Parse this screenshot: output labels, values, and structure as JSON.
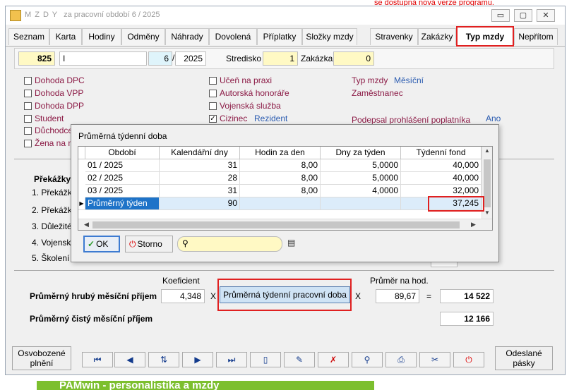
{
  "background": {
    "notice": "se dostupná nová verze programu.",
    "banner": "PAMwin - personalistika a mzdy"
  },
  "window": {
    "title": "M Z D Y",
    "subtitle": "za pracovní období  6 / 2025"
  },
  "tabs": [
    "Seznam",
    "Karta",
    "Hodiny",
    "Odměny",
    "Náhrady",
    "Dovolená",
    "Příplatky",
    "Složky mzdy",
    "Stravenky",
    "Zakázky",
    "Typ mzdy",
    "Nepřítom"
  ],
  "header": {
    "id": "825",
    "name": "I",
    "month": "6",
    "slash": "/",
    "year": "2025",
    "stredisko_label": "Stredisko",
    "stredisko": "1",
    "zakazka_label": "Zakázka",
    "zakazka": "0"
  },
  "checks_left": [
    {
      "label": "Dohoda DPC",
      "checked": false
    },
    {
      "label": "Dohoda VPP",
      "checked": false
    },
    {
      "label": "Dohoda DPP",
      "checked": false
    },
    {
      "label": "Student",
      "checked": false
    },
    {
      "label": "Důchodce",
      "checked": false
    },
    {
      "label": "Žena na m",
      "checked": false
    }
  ],
  "checks_mid": [
    {
      "label": "Učeň na praxi",
      "checked": false
    },
    {
      "label": "Autorská honoráře",
      "checked": false
    },
    {
      "label": "Vojenská služba",
      "checked": false
    },
    {
      "label": "Cizinec",
      "checked": true
    }
  ],
  "info": {
    "rezident": "Rezident",
    "typ_mzdy_label": "Typ mzdy",
    "typ_mzdy": "Měsíční",
    "zamestnanec": "Zaměstnanec",
    "prohlaseni_label": "Podepsal prohlášení poplatníka",
    "prohlaseni": "Ano"
  },
  "obstacles": {
    "title": "Překážky",
    "items": [
      "1. Překážk",
      "2. Překážk",
      "3. Důležité",
      "4. Vojensk",
      "5. Školení"
    ]
  },
  "dialog": {
    "title": "Průměrná týdenní doba",
    "columns": [
      "Období",
      "Kalendářní dny",
      "Hodin za den",
      "Dny za týden",
      "Týdenní fond"
    ],
    "rows": [
      [
        "01 / 2025",
        "31",
        "8,00",
        "5,0000",
        "40,000"
      ],
      [
        "02 / 2025",
        "28",
        "8,00",
        "5,0000",
        "40,000"
      ],
      [
        "03 / 2025",
        "31",
        "8,00",
        "4,0000",
        "32,000"
      ],
      [
        "Průměrný týden",
        "90",
        "",
        "",
        "37,245"
      ]
    ],
    "ok": "OK",
    "storno": "Storno",
    "search_placeholder": ""
  },
  "summary": {
    "koeficient_label": "Koeficient",
    "prumer_label": "Průměr na hod.",
    "hruby_label": "Průměrný hrubý měsíční příjem",
    "koeficient": "4,348",
    "x1": "X",
    "weekly_button": "Průměrná týdenní pracovní doba",
    "x2": "X",
    "prumer": "89,67",
    "eq": "=",
    "hruby": "14 522",
    "cisty_label": "Průměrný čistý měsíční příjem",
    "cisty": "12 166"
  },
  "bottom": {
    "osvobozene": "Osvobozené plnění",
    "odeslane": "Odeslané pásky"
  },
  "colors": {
    "highlight_red": "#e02020",
    "label_maroon": "#8b1a45",
    "value_blue": "#2a5bb0",
    "yellow_field": "#fff9c4"
  }
}
